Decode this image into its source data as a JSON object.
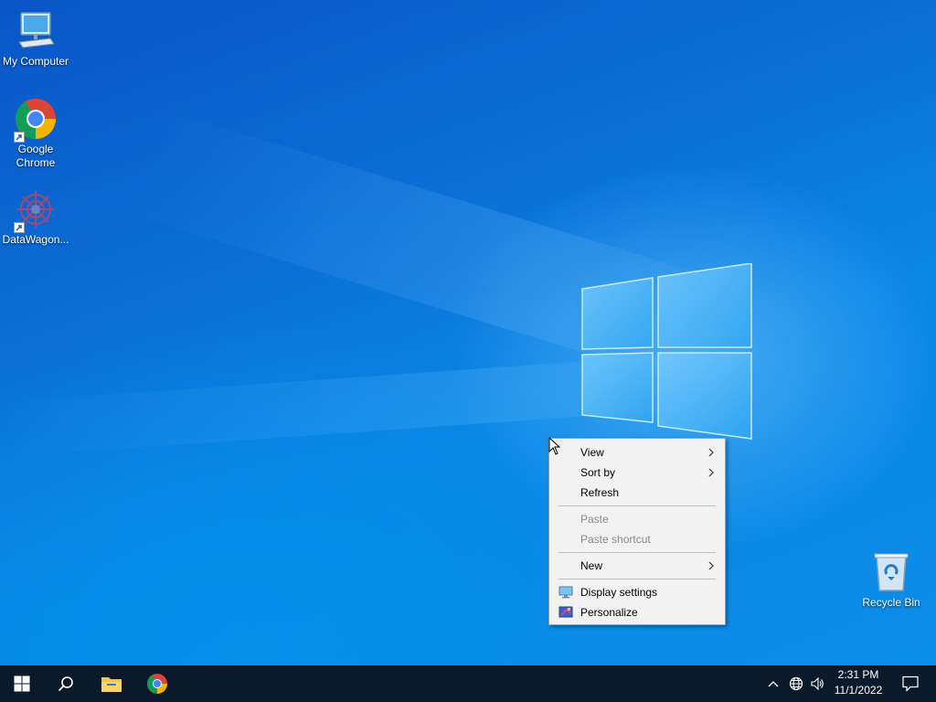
{
  "desktop": {
    "icons": [
      {
        "label": "My Computer",
        "icon": "computer-icon",
        "shortcut": false
      },
      {
        "label": "Google\nChrome",
        "label_line1": "Google",
        "label_line2": "Chrome",
        "icon": "chrome-icon",
        "shortcut": true
      },
      {
        "label": "DataWagon...",
        "icon": "datawagon-icon",
        "shortcut": true
      },
      {
        "label": "Recycle Bin",
        "icon": "recycle-bin-icon",
        "shortcut": false
      }
    ]
  },
  "context_menu": {
    "items": {
      "view": {
        "label": "View",
        "submenu": true
      },
      "sort_by": {
        "label": "Sort by",
        "submenu": true
      },
      "refresh": {
        "label": "Refresh"
      },
      "paste": {
        "label": "Paste",
        "disabled": true
      },
      "paste_shortcut": {
        "label": "Paste shortcut",
        "disabled": true
      },
      "new": {
        "label": "New",
        "submenu": true
      },
      "display_settings": {
        "label": "Display settings",
        "icon": "display-settings-icon"
      },
      "personalize": {
        "label": "Personalize",
        "icon": "personalize-icon"
      }
    }
  },
  "taskbar": {
    "buttons": [
      "start-icon",
      "search-icon",
      "file-explorer-icon",
      "chrome-icon"
    ],
    "tray_icons": [
      "chevron-up-icon",
      "network-globe-icon",
      "volume-icon"
    ],
    "clock": {
      "time": "2:31 PM",
      "date": "11/1/2022"
    },
    "notification_icon": "action-center-icon"
  },
  "colors": {
    "taskbar": "#0b1a2b",
    "menu_bg": "#f2f2f2",
    "desktop_accent": "#0a6fd6"
  }
}
